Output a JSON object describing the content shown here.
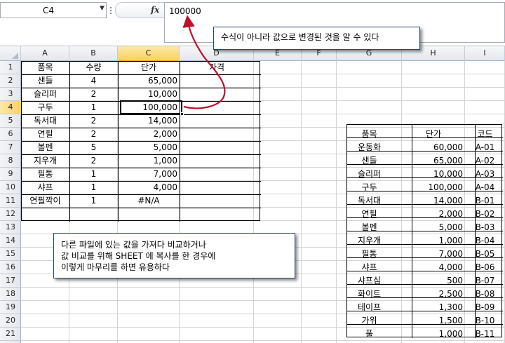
{
  "formula_bar": {
    "name_box": "C4",
    "fx_label": "fx",
    "formula": "100000"
  },
  "columns": [
    "A",
    "B",
    "C",
    "D",
    "E",
    "F",
    "G",
    "H",
    "I"
  ],
  "rows": [
    "1",
    "2",
    "3",
    "4",
    "5",
    "6",
    "7",
    "8",
    "9",
    "10",
    "11",
    "12",
    "13",
    "14",
    "15",
    "16",
    "17",
    "18",
    "19",
    "20",
    "21"
  ],
  "left_table": {
    "headers": [
      "품목",
      "수량",
      "단가",
      "가격"
    ],
    "rows": [
      [
        "샌들",
        "4",
        "65,000",
        ""
      ],
      [
        "슬리퍼",
        "2",
        "10,000",
        ""
      ],
      [
        "구두",
        "1",
        "100,000",
        ""
      ],
      [
        "독서대",
        "2",
        "14,000",
        ""
      ],
      [
        "연필",
        "2",
        "2,000",
        ""
      ],
      [
        "볼펜",
        "5",
        "5,000",
        ""
      ],
      [
        "지우개",
        "2",
        "1,000",
        ""
      ],
      [
        "필통",
        "1",
        "7,000",
        ""
      ],
      [
        "샤프",
        "1",
        "4,000",
        ""
      ],
      [
        "연필깍이",
        "1",
        "#N/A",
        ""
      ],
      [
        "",
        "",
        "",
        ""
      ]
    ]
  },
  "right_table": {
    "headers": [
      "품목",
      "단가",
      "코드"
    ],
    "rows": [
      [
        "운동화",
        "60,000",
        "A-01"
      ],
      [
        "샌들",
        "65,000",
        "A-02"
      ],
      [
        "슬리퍼",
        "10,000",
        "A-03"
      ],
      [
        "구두",
        "100,000",
        "A-04"
      ],
      [
        "독서대",
        "14,000",
        "B-01"
      ],
      [
        "연필",
        "2,000",
        "B-02"
      ],
      [
        "볼펜",
        "5,000",
        "B-03"
      ],
      [
        "지우개",
        "1,000",
        "B-04"
      ],
      [
        "필통",
        "7,000",
        "B-05"
      ],
      [
        "샤프",
        "4,000",
        "B-06"
      ],
      [
        "샤프심",
        "500",
        "B-07"
      ],
      [
        "화이트",
        "2,500",
        "B-08"
      ],
      [
        "테이프",
        "1,300",
        "B-09"
      ],
      [
        "가위",
        "1,500",
        "B-10"
      ],
      [
        "풀",
        "1,000",
        "B-11"
      ]
    ]
  },
  "callouts": {
    "top": "수식이 아니라 값으로 변경된 것을 알 수 있다",
    "bottom": [
      "다른 파일에 있는 값을 가져다 비교하거나",
      "값 비교를 위해 SHEET 에 복사를 한 경우에",
      "이렇게 마무리를 하면 유용하다"
    ]
  },
  "colors": {
    "selection_highlight": "#f9d15f",
    "arrow": "#c0102a",
    "callout_border": "#27486e"
  }
}
